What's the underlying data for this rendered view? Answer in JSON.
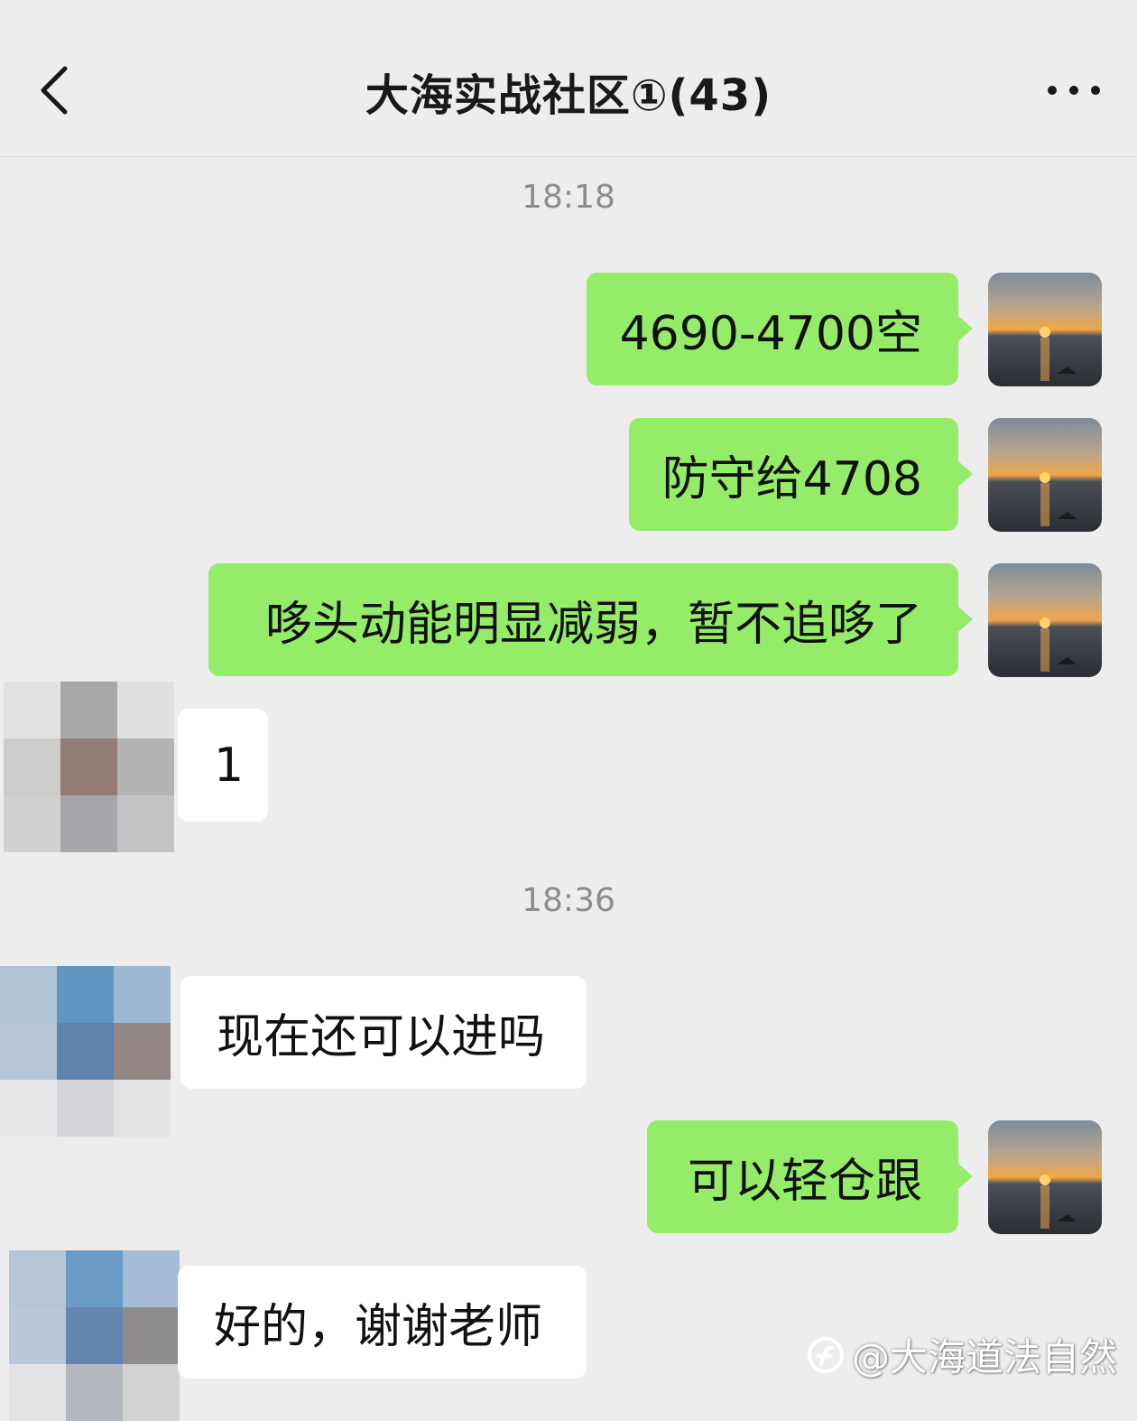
{
  "header": {
    "title": "大海实战社区①(43)"
  },
  "messages": {
    "t1": "18:18",
    "m1": "4690-4700空",
    "m2": "防守给4708",
    "m3": "哆头动能明显减弱，暂不追哆了",
    "m4": "1",
    "t2": "18:36",
    "m5": "现在还可以进吗",
    "m6": "可以轻仓跟",
    "m7": "好的，谢谢老师"
  },
  "watermark": {
    "text": "@大海道法自然"
  },
  "colors": {
    "background": "#ededed",
    "outgoing_bubble": "#95ec69",
    "incoming_bubble": "#ffffff"
  },
  "icons": {
    "back": "chevron-left-icon",
    "more": "more-dots-icon"
  }
}
